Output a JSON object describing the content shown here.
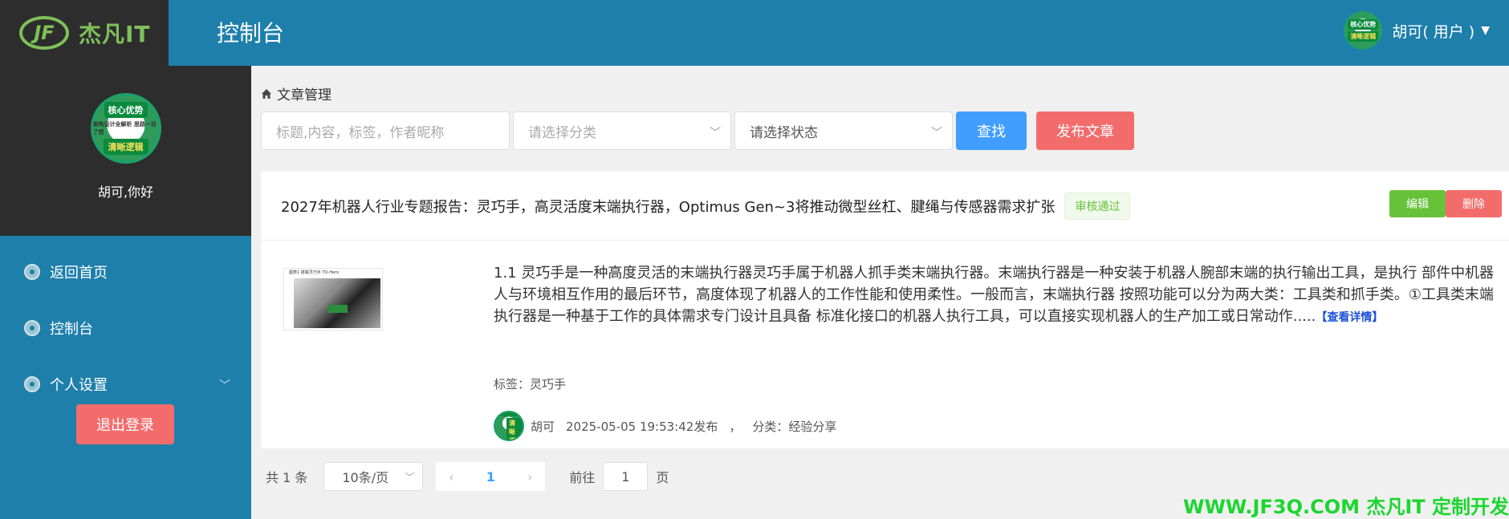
{
  "header": {
    "logo_mark": "JF",
    "logo_text": "杰凡IT",
    "title": "控制台",
    "user_label": "胡可( 用户 )",
    "avatar_top": "核心优势",
    "avatar_bottom": "清晰逻辑"
  },
  "sidebar": {
    "avatar_top": "核心优势",
    "avatar_mid": "架构设计全解析 思路一目了然",
    "avatar_bottom": "清晰逻辑",
    "greeting": "胡可,你好",
    "items": [
      {
        "label": "返回首页"
      },
      {
        "label": "控制台"
      },
      {
        "label": "个人设置"
      }
    ],
    "logout_label": "退出登录"
  },
  "breadcrumb": {
    "label": "文章管理"
  },
  "filters": {
    "search_placeholder": "标题,内容，标签，作者昵称",
    "category_placeholder": "请选择分类",
    "status_placeholder": "请选择状态",
    "search_label": "查找",
    "publish_label": "发布文章"
  },
  "article": {
    "title": "2027年机器人行业专题报告：灵巧手，高灵活度末端执行器，Optimus Gen~3将推动微型丝杠、腱绳与传感器需求扩张",
    "status": "审核通过",
    "edit_label": "编辑",
    "delete_label": "删除",
    "thumb_caption": "图表1 搭载灵巧手 TO-Hero",
    "excerpt": "1.1 灵巧手是一种高度灵活的末端执行器灵巧手属于机器人抓手类末端执行器。末端执行器是一种安装于机器人腕部末端的执行输出工具，是执行 部件中机器人与环境相互作用的最后环节，高度体现了机器人的工作性能和使用柔性。一般而言，末端执行器 按照功能可以分为两大类：工具类和抓手类。①工具类末端执行器是一种基于工作的具体需求专门设计且具备 标准化接口的机器人执行工具，可以直接实现机器人的生产加工或日常动作.....",
    "more_label": "【查看详情】",
    "tags": "标签：灵巧手",
    "author": "胡可",
    "published": "2025-05-05 19:53:42发布",
    "separator": "，",
    "category": "分类：经验分享"
  },
  "pagination": {
    "total": "共 1 条",
    "page_size": "10条/页",
    "current_page": "1",
    "goto_label": "前往",
    "goto_value": "1",
    "page_unit": "页"
  },
  "watermark": "WWW.JF3Q.COM 杰凡IT  定制开发",
  "colors": {
    "header_bg": "#1e7fab",
    "sidebar_dark": "#2d2d2d",
    "primary": "#409eff",
    "danger": "#f36c6c",
    "success": "#67c23a",
    "watermark": "#1bd62e"
  }
}
